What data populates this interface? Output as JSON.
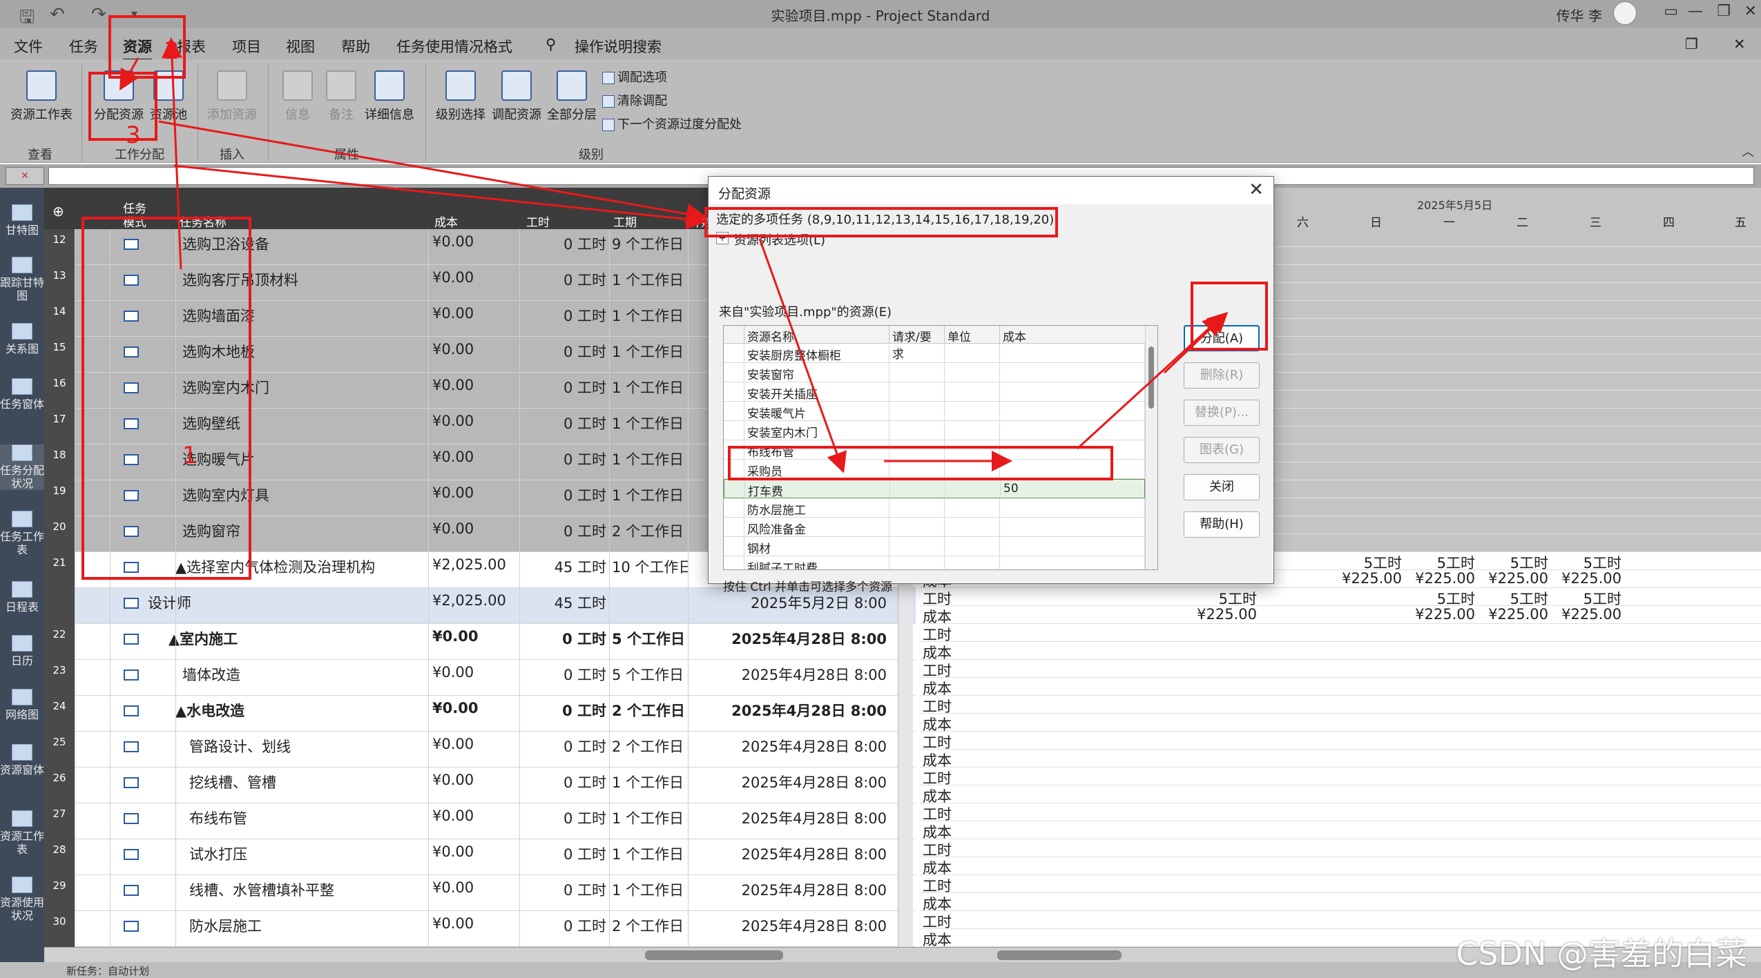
{
  "titlebar": {
    "title": "实验项目.mpp - Project Standard",
    "user": "传华 李"
  },
  "menu_tabs": [
    "文件",
    "任务",
    "资源",
    "报表",
    "项目",
    "视图",
    "帮助",
    "任务使用情况格式"
  ],
  "menu_active": "资源",
  "menu_search": "操作说明搜索",
  "ribbon": {
    "resource_sheet": "资源工作表",
    "assign_resources": "分配资源",
    "resource_pool": "资源池",
    "add_resource": "添加资源",
    "info": "信息",
    "notes": "备注",
    "details": "详细信息",
    "level_selection": "级别选择",
    "level_resource": "调配资源",
    "level_all": "全部分层",
    "leveling_options": "调配选项",
    "clear_leveling": "清除调配",
    "next_overallocation": "下一个资源过度分配处",
    "groups": {
      "view": "查看",
      "assignments": "工作分配",
      "insert": "插入",
      "properties": "属性",
      "level": "级别"
    }
  },
  "viewbar": [
    "甘特图",
    "跟踪甘特图",
    "关系图",
    "任务窗体",
    "任务分配状况",
    "任务工作表",
    "日程表",
    "日历",
    "网络图",
    "资源窗体",
    "资源工作表",
    "资源使用状况"
  ],
  "grid_header": {
    "task": "任务",
    "mode": "模式",
    "name": "任务名称",
    "cost": "成本",
    "work": "工时",
    "duration": "工期",
    "start": "开始"
  },
  "rows": [
    {
      "id": "12",
      "name": "选购卫浴设备",
      "cost": "¥0.00",
      "work": "0 工时",
      "dur": "9 个工作日",
      "start": ""
    },
    {
      "id": "13",
      "name": "选购客厅吊顶材料",
      "cost": "¥0.00",
      "work": "0 工时",
      "dur": "1 个工作日",
      "start": ""
    },
    {
      "id": "14",
      "name": "选购墙面漆",
      "cost": "¥0.00",
      "work": "0 工时",
      "dur": "1 个工作日",
      "start": ""
    },
    {
      "id": "15",
      "name": "选购木地板",
      "cost": "¥0.00",
      "work": "0 工时",
      "dur": "1 个工作日",
      "start": ""
    },
    {
      "id": "16",
      "name": "选购室内木门",
      "cost": "¥0.00",
      "work": "0 工时",
      "dur": "1 个工作日",
      "start": ""
    },
    {
      "id": "17",
      "name": "选购壁纸",
      "cost": "¥0.00",
      "work": "0 工时",
      "dur": "1 个工作日",
      "start": ""
    },
    {
      "id": "18",
      "name": "选购暖气片",
      "cost": "¥0.00",
      "work": "0 工时",
      "dur": "1 个工作日",
      "start": ""
    },
    {
      "id": "19",
      "name": "选购室内灯具",
      "cost": "¥0.00",
      "work": "0 工时",
      "dur": "1 个工作日",
      "start": ""
    },
    {
      "id": "20",
      "name": "选购窗帘",
      "cost": "¥0.00",
      "work": "0 工时",
      "dur": "2 个工作日",
      "start": ""
    },
    {
      "id": "21",
      "name": "▲选择室内气体检测及治理机构",
      "cost": "¥2,025.00",
      "work": "45 工时",
      "dur": "10 个工作日",
      "start": ""
    },
    {
      "id": "",
      "name": "设计师",
      "cost": "¥2,025.00",
      "work": "45 工时",
      "dur": "",
      "start": "2025年5月2日 8:00"
    },
    {
      "id": "22",
      "name": "▲室内施工",
      "cost": "¥0.00",
      "work": "0 工时",
      "dur": "5 个工作日",
      "start": "2025年4月28日 8:00"
    },
    {
      "id": "23",
      "name": "墙体改造",
      "cost": "¥0.00",
      "work": "0 工时",
      "dur": "5 个工作日",
      "start": "2025年4月28日 8:00"
    },
    {
      "id": "24",
      "name": "▲水电改造",
      "cost": "¥0.00",
      "work": "0 工时",
      "dur": "2 个工作日",
      "start": "2025年4月28日 8:00"
    },
    {
      "id": "25",
      "name": "管路设计、划线",
      "cost": "¥0.00",
      "work": "0 工时",
      "dur": "2 个工作日",
      "start": "2025年4月28日 8:00"
    },
    {
      "id": "26",
      "name": "挖线槽、管槽",
      "cost": "¥0.00",
      "work": "0 工时",
      "dur": "1 个工作日",
      "start": "2025年4月28日 8:00"
    },
    {
      "id": "27",
      "name": "布线布管",
      "cost": "¥0.00",
      "work": "0 工时",
      "dur": "1 个工作日",
      "start": "2025年4月28日 8:00"
    },
    {
      "id": "28",
      "name": "试水打压",
      "cost": "¥0.00",
      "work": "0 工时",
      "dur": "1 个工作日",
      "start": "2025年4月28日 8:00"
    },
    {
      "id": "29",
      "name": "线槽、水管槽填补平整",
      "cost": "¥0.00",
      "work": "0 工时",
      "dur": "1 个工作日",
      "start": "2025年4月28日 8:00"
    },
    {
      "id": "30",
      "name": "防水层施工",
      "cost": "¥0.00",
      "work": "0 工时",
      "dur": "2 个工作日",
      "start": "2025年4月28日 8:00"
    }
  ],
  "timephased": {
    "week_label": "2025年5月5日",
    "days": [
      "六",
      "日",
      "一",
      "二",
      "三",
      "四",
      "五"
    ],
    "label_work": "工时",
    "label_cost": "成本",
    "work_val": "5工时",
    "cost_val": "¥225.00"
  },
  "dialog": {
    "title": "分配资源",
    "selected": "选定的多项任务 (8,9,10,11,12,13,14,15,16,17,18,19,20)",
    "options": "资源列表选项(L)",
    "from": "来自\"实验项目.mpp\"的资源(E)",
    "col_name": "资源名称",
    "col_req": "请求/要求",
    "col_unit": "单位",
    "col_cost": "成本",
    "resources": [
      "安装厨房整体橱柜",
      "安装窗帘",
      "安装开关插座",
      "安装暖气片",
      "安装室内木门",
      "布线布管",
      "采购员",
      "打车费",
      "防水层施工",
      "风险准备金",
      "钢材",
      "刮腻子工时费"
    ],
    "selected_resource": "打车费",
    "selected_cost": "50",
    "hint": "按住 Ctrl 并单击可选择多个资源",
    "buttons": {
      "assign": "分配(A)",
      "remove": "删除(R)",
      "replace": "替换(P)...",
      "graph": "图表(G)",
      "close": "关闭",
      "help": "帮助(H)"
    }
  },
  "annotations": {
    "n1": "1",
    "n2": "2",
    "n3": "3"
  },
  "status": "新任务：自动计划",
  "watermark": "CSDN @害羞的白菜"
}
